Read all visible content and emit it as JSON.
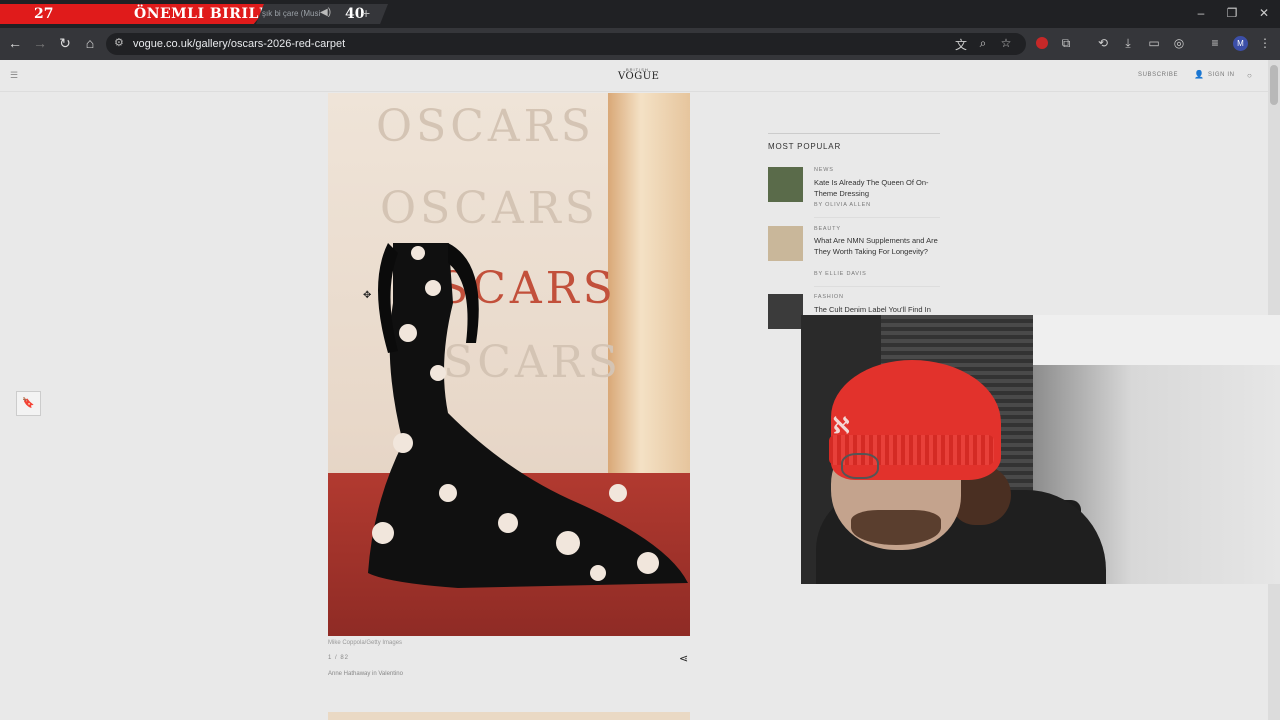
{
  "stream_overlay": {
    "left_number": "27",
    "title": "ÖNEMLI BIRILERI",
    "right_number": "40"
  },
  "browser": {
    "tab_title": "şık bi çare (Musi",
    "url": "vogue.co.uk/gallery/oscars-2026-red-carpet",
    "profile_initial": "M"
  },
  "site": {
    "logo_small": "BRITISH",
    "logo": "VOGUE",
    "subscribe": "SUBSCRIBE",
    "sign_in": "SIGN IN"
  },
  "photo": {
    "backdrop_text": "OSCARS",
    "credit": "Mike Coppola/Getty Images",
    "counter": "1 / 82",
    "caption": "Anne Hathaway in Valentino"
  },
  "most_popular": {
    "title": "MOST POPULAR",
    "items": [
      {
        "category": "NEWS",
        "headline": "Kate Is Already The Queen Of On-Theme Dressing",
        "byline": "BY OLIVIA ALLEN",
        "thumb_color": "#5a6b4a"
      },
      {
        "category": "BEAUTY",
        "headline": "What Are NMN Supplements and Are They Worth Taking For Longevity?",
        "byline": "BY ELLIE DAVIS",
        "thumb_color": "#c9b79a"
      },
      {
        "category": "FASHION",
        "headline": "The Cult Denim Label You'll Find In",
        "byline": "",
        "thumb_color": "#3b3b3b"
      }
    ]
  },
  "colors": {
    "overlay_red": "#e01b1b",
    "chrome_dark": "#202124",
    "beanie_red": "#e2322c"
  }
}
